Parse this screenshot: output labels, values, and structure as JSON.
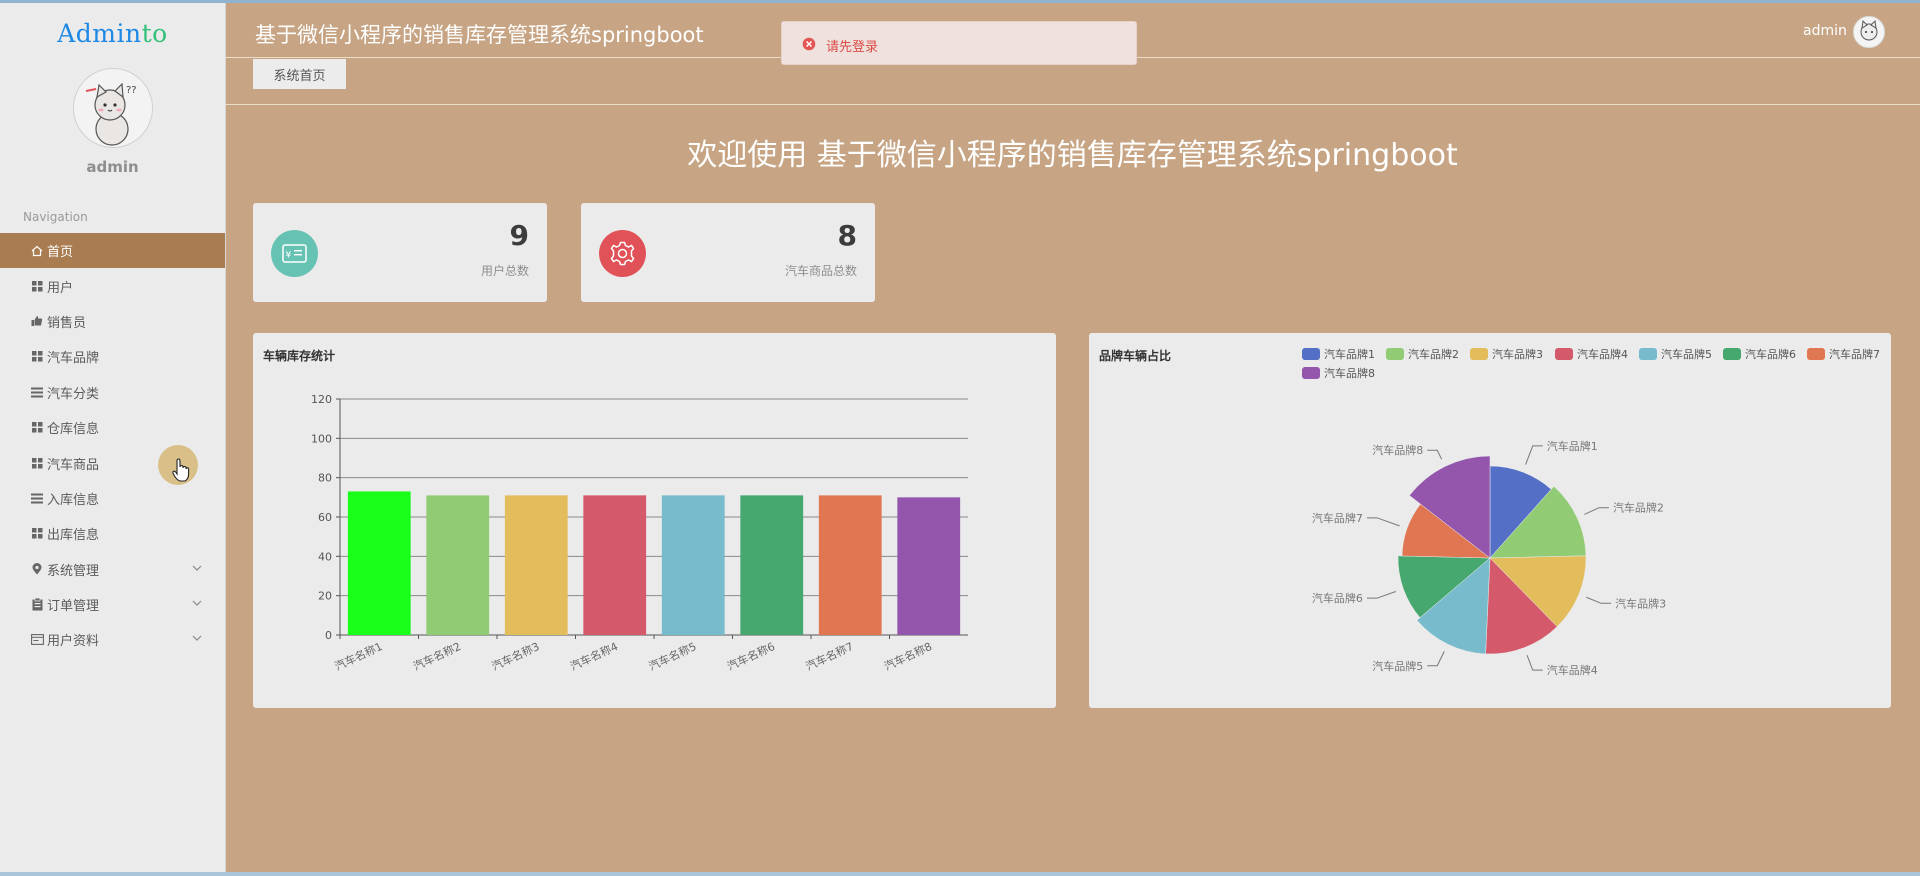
{
  "app": {
    "title": "基于微信小程序的销售库存管理系统springboot",
    "logo_main": "Admin",
    "logo_accent": "to"
  },
  "toast": {
    "message": "请先登录",
    "color": "#dd4b45"
  },
  "user": {
    "name": "admin"
  },
  "sidebar": {
    "username": "admin",
    "nav_title": "Navigation",
    "items": [
      {
        "label": "首页",
        "icon": "home-icon",
        "active": true
      },
      {
        "label": "用户",
        "icon": "grid-icon"
      },
      {
        "label": "销售员",
        "icon": "thumbs-up-icon"
      },
      {
        "label": "汽车品牌",
        "icon": "grid-icon"
      },
      {
        "label": "汽车分类",
        "icon": "list-icon"
      },
      {
        "label": "仓库信息",
        "icon": "grid-icon"
      },
      {
        "label": "汽车商品",
        "icon": "grid-icon"
      },
      {
        "label": "入库信息",
        "icon": "list-icon"
      },
      {
        "label": "出库信息",
        "icon": "grid-icon"
      },
      {
        "label": "系统管理",
        "icon": "location-pin-icon",
        "expandable": true
      },
      {
        "label": "订单管理",
        "icon": "clipboard-icon",
        "expandable": true
      },
      {
        "label": "用户资料",
        "icon": "id-card-icon",
        "expandable": true
      }
    ]
  },
  "tabs": [
    {
      "label": "系统首页"
    }
  ],
  "welcome": "欢迎使用 基于微信小程序的销售库存管理系统springboot",
  "stats": [
    {
      "value": "9",
      "label": "用户总数",
      "icon": "payment-card-icon",
      "color": "#66c2b3"
    },
    {
      "value": "8",
      "label": "汽车商品总数",
      "icon": "gear-icon",
      "color": "#e05258"
    }
  ],
  "chart_data": [
    {
      "type": "bar",
      "title": "车辆库存统计",
      "categories": [
        "汽车名称1",
        "汽车名称2",
        "汽车名称3",
        "汽车名称4",
        "汽车名称5",
        "汽车名称6",
        "汽车名称7",
        "汽车名称8"
      ],
      "values": [
        73,
        71,
        71,
        71,
        71,
        71,
        71,
        70
      ],
      "colors": [
        "#1aff1a",
        "#91cc75",
        "#e3bd5c",
        "#d4596b",
        "#78bbcd",
        "#46a86e",
        "#e07752",
        "#9356ac"
      ],
      "yticks": [
        0,
        20,
        40,
        60,
        80,
        100,
        120
      ],
      "ylim": [
        0,
        120
      ],
      "grid": true
    },
    {
      "type": "pie",
      "title": "品牌车辆占比",
      "labels": [
        "汽车品牌1",
        "汽车品牌2",
        "汽车品牌3",
        "汽车品牌4",
        "汽车品牌5",
        "汽车品牌6",
        "汽车品牌7",
        "汽车品牌8"
      ],
      "values": [
        8,
        9,
        9,
        9,
        9,
        8,
        7,
        10
      ],
      "colors": [
        "#5470c6",
        "#91cc75",
        "#e3bd5c",
        "#d4596b",
        "#78bbcd",
        "#46a86e",
        "#e07752",
        "#9356ac"
      ],
      "legend": "top"
    }
  ]
}
